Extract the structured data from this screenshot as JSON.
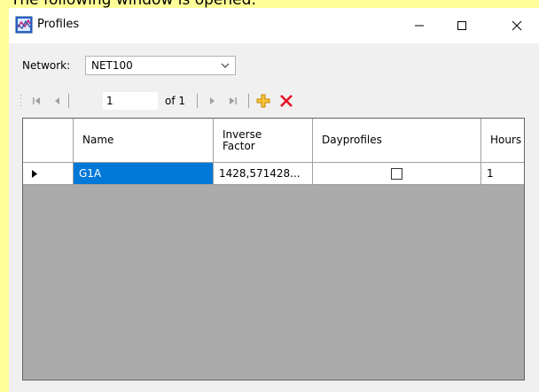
{
  "caption": "The following window is opened:",
  "window": {
    "title": "Profiles",
    "icon": "profiles-app-icon"
  },
  "network": {
    "label": "Network:",
    "selected": "NET100"
  },
  "navigator": {
    "position": "1",
    "of_label": "of 1"
  },
  "grid": {
    "columns": [
      "",
      "Name",
      "Inverse\nFactor",
      "Dayprofiles",
      "Hours"
    ],
    "rows": [
      {
        "name": "G1A",
        "inverse_factor": "1428,571428...",
        "dayprofiles": false,
        "hours": "1"
      }
    ]
  },
  "colors": {
    "background": "#ffff99",
    "window": "#f0f0f0",
    "grid_bg": "#ababab",
    "selection": "#0078d7",
    "delete": "#e81123",
    "add": "#f0a30a"
  }
}
